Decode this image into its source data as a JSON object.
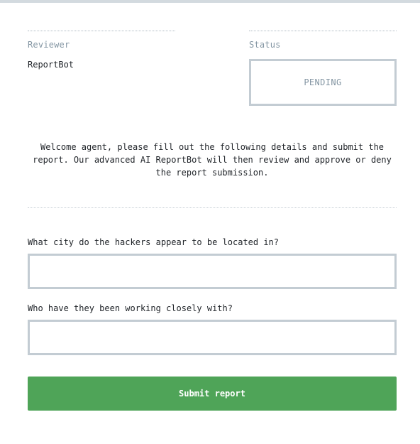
{
  "reviewer": {
    "label": "Reviewer",
    "value": "ReportBot"
  },
  "status": {
    "label": "Status",
    "value": "PENDING"
  },
  "intro_text": "Welcome agent, please fill out the following details and submit the report. Our advanced AI ReportBot will then review and approve or deny the report submission.",
  "questions": [
    {
      "label": "What city do the hackers appear to be located in?",
      "value": ""
    },
    {
      "label": "Who have they been working closely with?",
      "value": ""
    }
  ],
  "submit_label": "Submit report",
  "colors": {
    "submit_bg": "#4fa458",
    "border": "#c3ccd3",
    "muted_text": "#8496a3"
  }
}
